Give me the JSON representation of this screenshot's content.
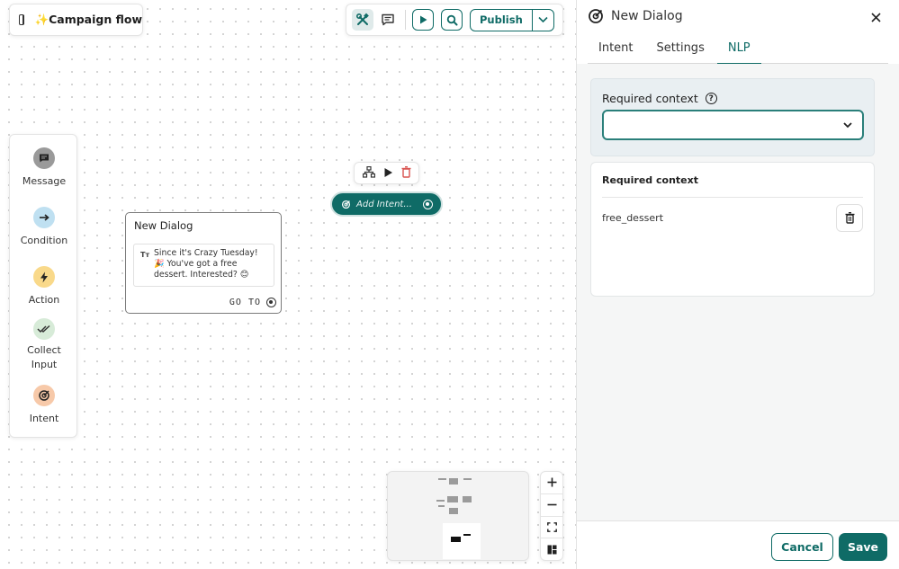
{
  "flow": {
    "title": "✨Campaign flow"
  },
  "toolbar": {
    "publish_label": "Publish"
  },
  "palette": {
    "items": [
      {
        "label": "Message",
        "icon": "message-icon",
        "color": "#9a9a9a"
      },
      {
        "label": "Condition",
        "icon": "arrow-right-icon",
        "color": "#bfe0f1"
      },
      {
        "label": "Action",
        "icon": "bolt-icon",
        "color": "#f9d98a"
      },
      {
        "label": "Collect Input",
        "icon": "double-check-icon",
        "color": "#d7ebd8"
      },
      {
        "label": "Intent",
        "icon": "target-icon",
        "color": "#f7c9a9"
      }
    ]
  },
  "node": {
    "title": "New Dialog",
    "message": "Since it's Crazy Tuesday! 🎉 You've got a free dessert. Interested? 😊",
    "text_type": "Tт",
    "goto_label": "GO TO"
  },
  "intent_pill": {
    "label": "Add Intent..."
  },
  "panel": {
    "title": "New Dialog",
    "tabs": [
      {
        "label": "Intent",
        "active": false
      },
      {
        "label": "Settings",
        "active": false
      },
      {
        "label": "NLP",
        "active": true
      }
    ],
    "required_context_label": "Required context",
    "help_glyph": "?",
    "select_value": "",
    "list_title": "Required context",
    "contexts": [
      "free_dessert"
    ],
    "cancel_label": "Cancel",
    "save_label": "Save"
  },
  "colors": {
    "brand": "#0f6b66",
    "delete": "#d9534f"
  }
}
